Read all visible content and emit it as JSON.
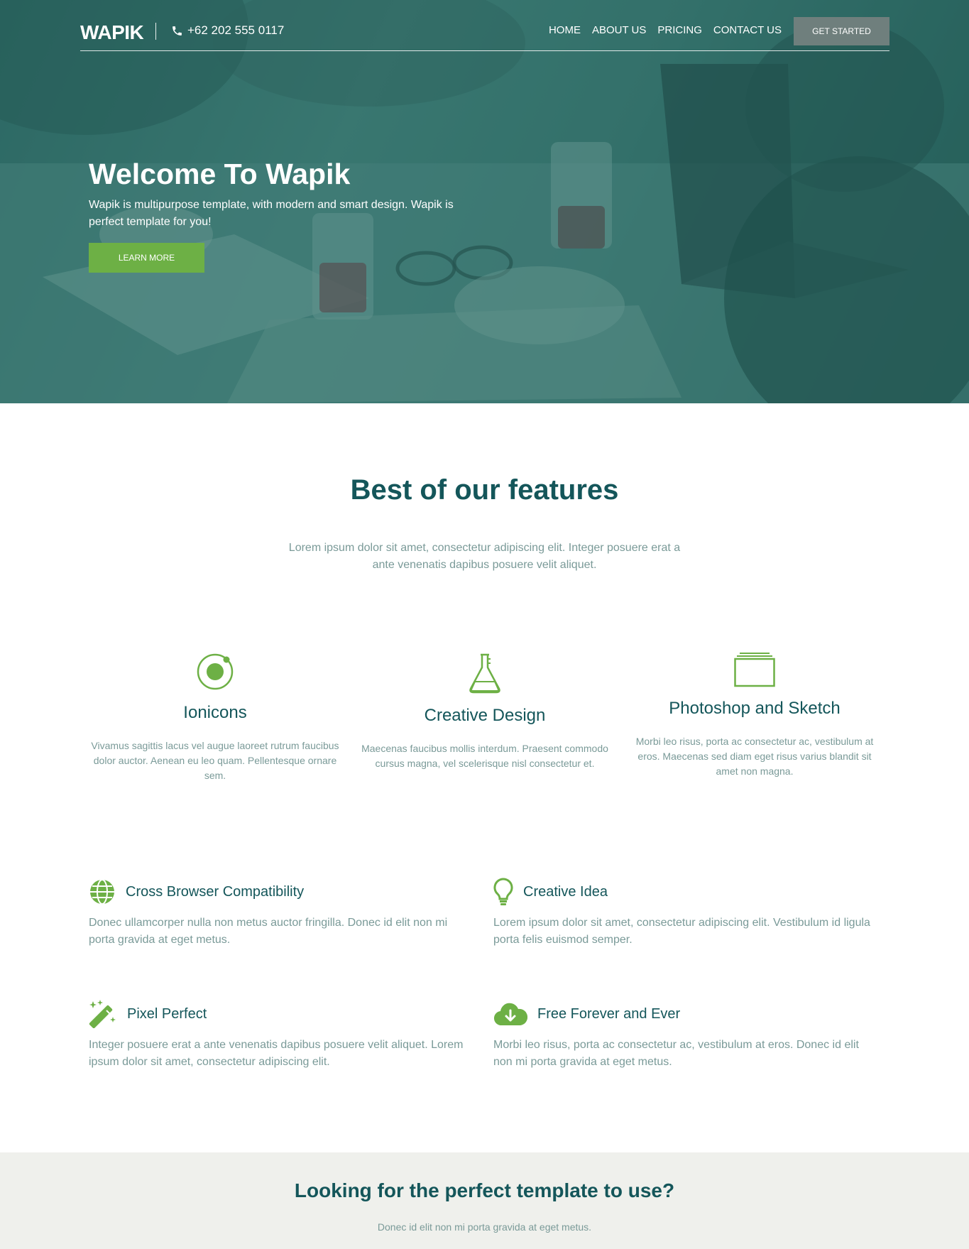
{
  "colors": {
    "primary": "#14565a",
    "accent_green": "#6db045",
    "muted_text": "#7a9a98",
    "button_gray": "#6f7f7d",
    "cta_background": "#eff0ec"
  },
  "header": {
    "logo": "WAPIK",
    "phone_icon": "phone-icon",
    "phone": "+62 202 555 0117",
    "nav": [
      "HOME",
      "ABOUT US",
      "PRICING",
      "CONTACT US"
    ],
    "cta_label": "GET STARTED"
  },
  "hero": {
    "title": "Welcome To Wapik",
    "text": "Wapik is multipurpose template, with modern and smart design. Wapik is perfect template for you!",
    "button_label": "LEARN MORE"
  },
  "features": {
    "title": "Best of our features",
    "subtitle": "Lorem ipsum dolor sit amet, consectetur adipiscing elit. Integer posuere erat a ante venenatis dapibus posuere velit aliquet.",
    "items": [
      {
        "icon": "ionic-icon",
        "title": "Ionicons",
        "text": "Vivamus sagittis lacus vel augue laoreet rutrum faucibus dolor auctor. Aenean eu leo quam. Pellentesque ornare sem."
      },
      {
        "icon": "flask-icon",
        "title": "Creative Design",
        "text": "Maecenas faucibus mollis interdum. Praesent commodo cursus magna, vel scelerisque nisl consectetur et."
      },
      {
        "icon": "layers-icon",
        "title": "Photoshop and Sketch",
        "text": "Morbi leo risus, porta ac consectetur ac, vestibulum at eros. Maecenas sed diam eget risus varius blandit sit amet non magna."
      }
    ],
    "small_items": [
      {
        "icon": "globe-icon",
        "title": "Cross Browser Compatibility",
        "text": "Donec ullamcorper nulla non metus auctor fringilla. Donec id elit non mi porta gravida at eget metus."
      },
      {
        "icon": "lightbulb-icon",
        "title": "Creative Idea",
        "text": "Lorem ipsum dolor sit amet, consectetur adipiscing elit. Vestibulum id ligula porta felis euismod semper."
      },
      {
        "icon": "magic-wand-icon",
        "title": "Pixel Perfect",
        "text": "Integer posuere erat a ante venenatis dapibus posuere velit aliquet. Lorem ipsum dolor sit amet, consectetur adipiscing elit."
      },
      {
        "icon": "cloud-download-icon",
        "title": "Free Forever and Ever",
        "text": "Morbi leo risus, porta ac consectetur ac, vestibulum at eros. Donec id elit non mi porta gravida at eget metus."
      }
    ]
  },
  "cta": {
    "title": "Looking for the perfect template to use?",
    "subtitle": "Donec id elit non mi porta gravida at eget metus."
  }
}
